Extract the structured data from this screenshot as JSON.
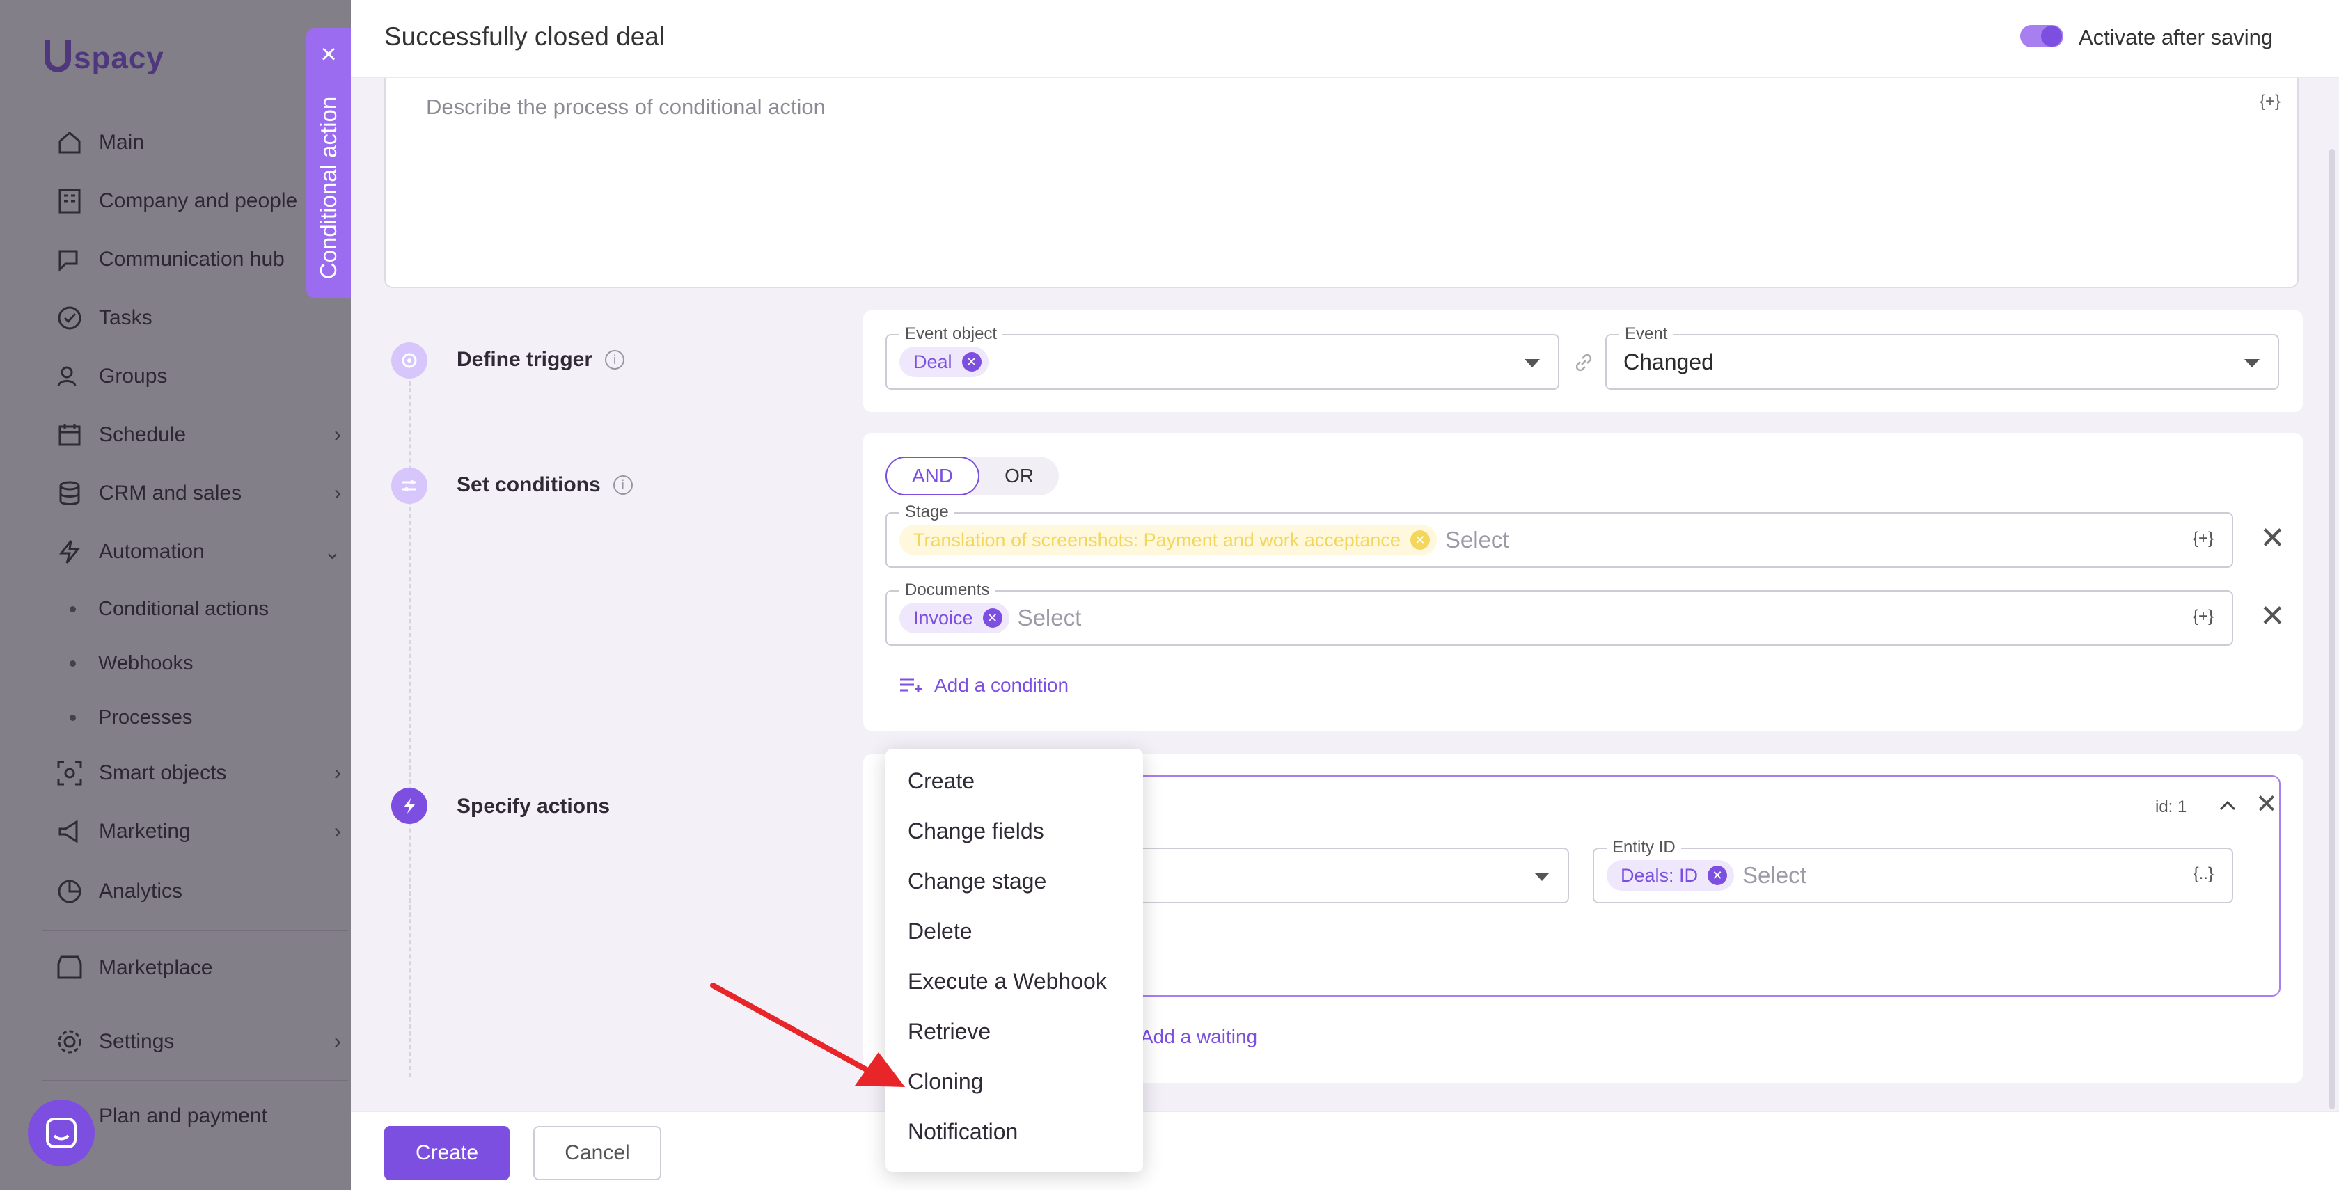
{
  "brand": {
    "logo_text": "spacy"
  },
  "sidebar": {
    "items": [
      {
        "label": "Main",
        "icon": "home-icon"
      },
      {
        "label": "Company and people",
        "icon": "building-icon"
      },
      {
        "label": "Communication hub",
        "icon": "chat-icon"
      },
      {
        "label": "Tasks",
        "icon": "check-circle-icon"
      },
      {
        "label": "Groups",
        "icon": "users-icon"
      },
      {
        "label": "Schedule",
        "icon": "calendar-icon"
      },
      {
        "label": "CRM and sales",
        "icon": "database-icon"
      },
      {
        "label": "Automation",
        "icon": "lightning-icon"
      },
      {
        "label": "Smart objects",
        "icon": "scan-icon"
      },
      {
        "label": "Marketing",
        "icon": "megaphone-icon"
      },
      {
        "label": "Analytics",
        "icon": "pie-icon"
      },
      {
        "label": "Marketplace",
        "icon": "store-icon"
      },
      {
        "label": "Settings",
        "icon": "gear-icon"
      },
      {
        "label": "Plan and payment",
        "icon": "card-icon"
      }
    ],
    "automation_sub": [
      "Conditional actions",
      "Webhooks",
      "Processes"
    ]
  },
  "side_tab": {
    "label": "Conditional action",
    "close": "×"
  },
  "header": {
    "title": "Successfully closed deal",
    "activate_label": "Activate after saving",
    "activate_on": true
  },
  "description": {
    "placeholder": "Describe the process of conditional action",
    "var_button": "{+}"
  },
  "trigger": {
    "label": "Define trigger",
    "event_object_label": "Event object",
    "event_object_chip": "Deal",
    "event_label": "Event",
    "event_value": "Changed"
  },
  "conditions": {
    "label": "Set conditions",
    "logic_options": [
      "AND",
      "OR"
    ],
    "logic_selected": "AND",
    "rows": [
      {
        "label": "Stage",
        "chip": "Translation of screenshots: Payment and work acceptance",
        "placeholder": "Select",
        "var": "{+}"
      },
      {
        "label": "Documents",
        "chip": "Invoice",
        "placeholder": "Select",
        "var": "{+}"
      }
    ],
    "add_condition": "Add a condition"
  },
  "actions": {
    "label": "Specify actions",
    "id_label": "id: 1",
    "entity_id_label": "Entity ID",
    "entity_chip": "Deals: ID",
    "entity_placeholder": "Select",
    "entity_var": "{..}",
    "add_waiting": "Add a waiting"
  },
  "dropdown": {
    "items": [
      "Create",
      "Change fields",
      "Change stage",
      "Delete",
      "Execute a Webhook",
      "Retrieve",
      "Cloning",
      "Notification"
    ]
  },
  "footer": {
    "create": "Create",
    "cancel": "Cancel"
  }
}
